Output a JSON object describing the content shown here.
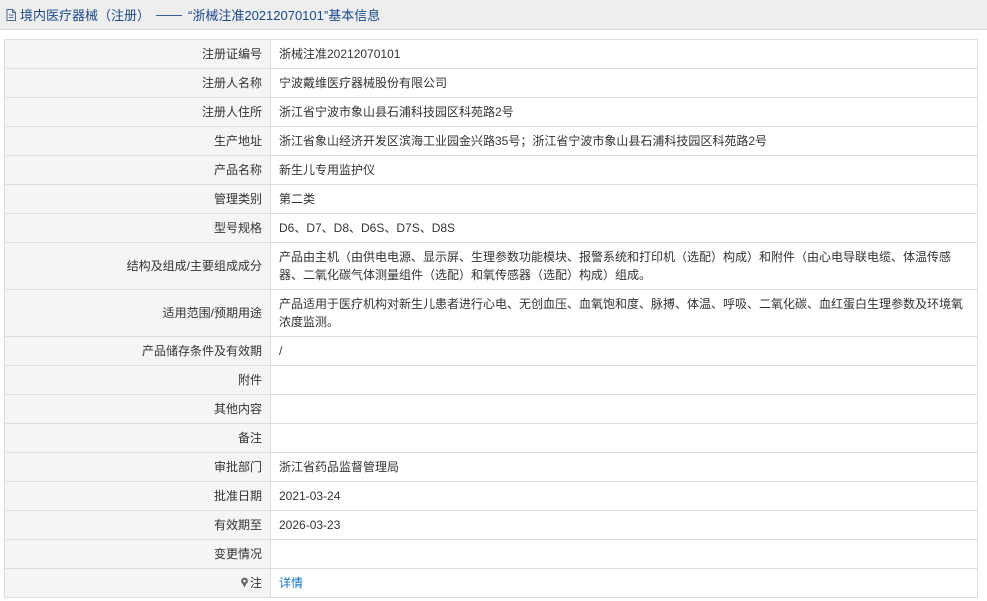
{
  "header": {
    "title_prefix": "境内医疗器械（注册）",
    "separator": "——",
    "title_main": "“浙械注准20212070101”基本信息",
    "icon": "document-icon"
  },
  "rows": [
    {
      "label": "注册证编号",
      "value": "浙械注准20212070101"
    },
    {
      "label": "注册人名称",
      "value": "宁波戴维医疗器械股份有限公司"
    },
    {
      "label": "注册人住所",
      "value": "浙江省宁波市象山县石浦科技园区科苑路2号"
    },
    {
      "label": "生产地址",
      "value": "浙江省象山经济开发区滨海工业园金兴路35号；浙江省宁波市象山县石浦科技园区科苑路2号"
    },
    {
      "label": "产品名称",
      "value": "新生儿专用监护仪"
    },
    {
      "label": "管理类别",
      "value": "第二类"
    },
    {
      "label": "型号规格",
      "value": "D6、D7、D8、D6S、D7S、D8S"
    },
    {
      "label": "结构及组成/主要组成成分",
      "value": "产品由主机（由供电电源、显示屏、生理参数功能模块、报警系统和打印机（选配）构成）和附件（由心电导联电缆、体温传感器、二氧化碳气体测量组件（选配）和氧传感器（选配）构成）组成。"
    },
    {
      "label": "适用范围/预期用途",
      "value": "产品适用于医疗机构对新生儿患者进行心电、无创血压、血氧饱和度、脉搏、体温、呼吸、二氧化碳、血红蛋白生理参数及环境氧浓度监测。"
    },
    {
      "label": "产品储存条件及有效期",
      "value": "/"
    },
    {
      "label": "附件",
      "value": ""
    },
    {
      "label": "其他内容",
      "value": ""
    },
    {
      "label": "备注",
      "value": ""
    },
    {
      "label": "审批部门",
      "value": "浙江省药品监督管理局"
    },
    {
      "label": "批准日期",
      "value": "2021-03-24"
    },
    {
      "label": "有效期至",
      "value": "2026-03-23"
    },
    {
      "label": "变更情况",
      "value": ""
    }
  ],
  "note": {
    "label": "注",
    "icon": "pin-icon",
    "link_text": "详情"
  },
  "colors": {
    "title_text": "#1a4a8a",
    "title_bg": "#eeeeee",
    "label_bg": "#f5f5f5",
    "border": "#dddddd",
    "link": "#1a73c7"
  }
}
